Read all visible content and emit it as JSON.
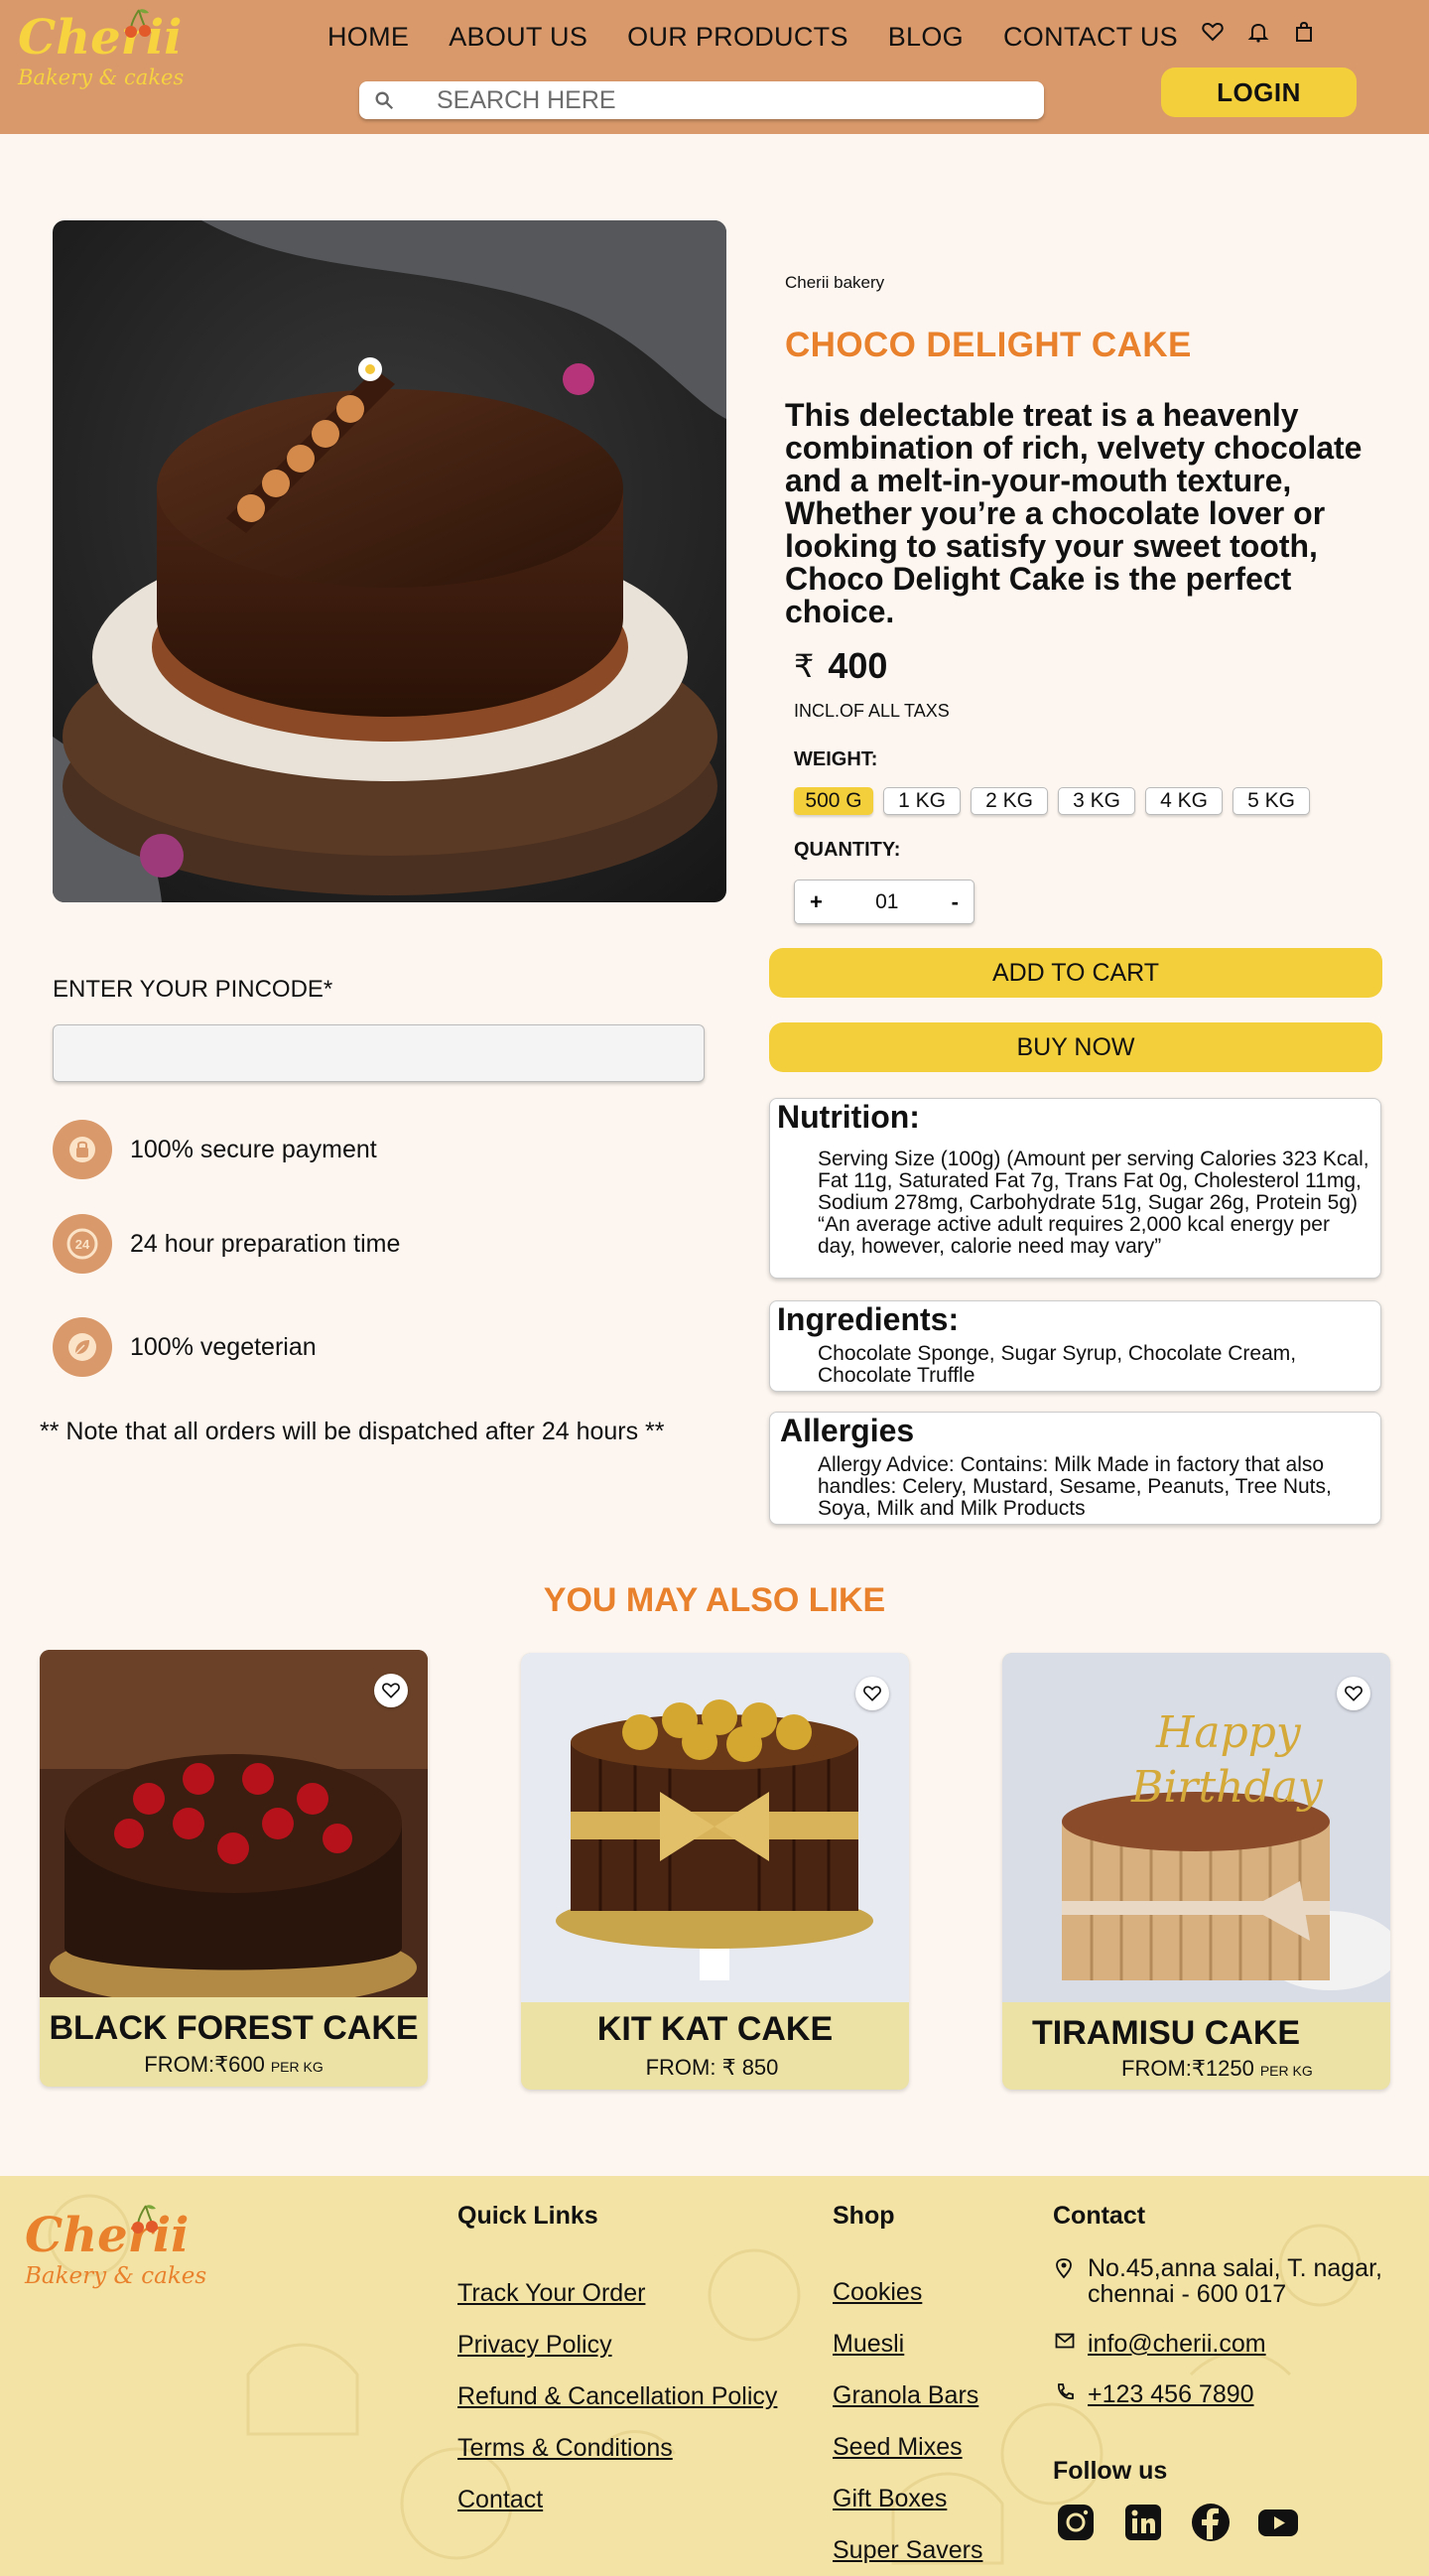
{
  "header": {
    "logo_main": "Cherii",
    "logo_sub": "Bakery & cakes",
    "nav": [
      "HOME",
      "ABOUT US",
      "OUR PRODUCTS",
      "BLOG",
      "CONTACT US"
    ],
    "search_placeholder": "SEARCH HERE",
    "icons": [
      "heart-icon",
      "bell-icon",
      "bag-icon"
    ],
    "login_label": "LOGIN"
  },
  "product": {
    "brand": "Cherii bakery",
    "title": "CHOCO DELIGHT CAKE",
    "description": "This delectable treat is a heavenly combination of rich, velvety chocolate and a melt-in-your-mouth texture, Whether you’re a chocolate lover or looking to satisfy your sweet tooth, Choco Delight Cake is the perfect choice.",
    "currency": "₹",
    "price": "400",
    "taxes": "INCL.OF ALL TAXS",
    "weight_label": "WEIGHT:",
    "weights": [
      "500 G",
      "1 KG",
      "2 KG",
      "3 KG",
      "4 KG",
      "5 KG"
    ],
    "selected_weight": "500 G",
    "quantity_label": "QUANTITY:",
    "quantity_plus": "+",
    "quantity_value": "01",
    "quantity_minus": "-",
    "add_to_cart": "ADD TO CART",
    "buy_now": "BUY NOW"
  },
  "pincode": {
    "label": "ENTER YOUR PINCODE*",
    "value": ""
  },
  "features": [
    {
      "icon": "lock-icon",
      "text": "100% secure payment"
    },
    {
      "icon": "clock-24-icon",
      "text": "24 hour preparation time"
    },
    {
      "icon": "leaf-icon",
      "text": "100% vegeterian"
    }
  ],
  "note": "** Note that all orders will be dispatched after 24 hours **",
  "nutrition": {
    "title": "Nutrition:",
    "text": "Serving Size (100g) (Amount per serving Calories 323 Kcal, Fat 11g, Saturated Fat 7g, Trans Fat 0g, Cholesterol 11mg, Sodium 278mg, Carbohydrate 51g, Sugar 26g, Protein 5g) “An average active adult requires 2,000 kcal energy per day, however, calorie need may vary”"
  },
  "ingredients": {
    "title": "Ingredients:",
    "text": "Chocolate Sponge, Sugar Syrup, Chocolate Cream, Chocolate Truffle"
  },
  "allergies": {
    "title": "Allergies",
    "text": "Allergy Advice: Contains: Milk Made in factory that also handles: Celery, Mustard, Sesame, Peanuts, Tree Nuts, Soya, Milk and Milk Products"
  },
  "related": {
    "title": "YOU MAY ALSO LIKE",
    "items": [
      {
        "name": "BLACK FOREST CAKE",
        "price": "FROM:₹600",
        "unit": "PER KG"
      },
      {
        "name": "KIT KAT CAKE",
        "price": "FROM: ₹ 850",
        "unit": ""
      },
      {
        "name": "TIRAMISU CAKE",
        "price": "FROM:₹1250",
        "unit": "PER KG"
      }
    ]
  },
  "footer": {
    "logo_main": "Cherii",
    "logo_sub": "Bakery & cakes",
    "quick_links_title": "Quick Links",
    "quick_links": [
      "Track Your Order",
      "Privacy Policy",
      "Refund & Cancellation Policy",
      "Terms & Conditions",
      "Contact"
    ],
    "shop_title": "Shop",
    "shop_links": [
      "Cookies",
      "Muesli",
      "Granola Bars",
      "Seed Mixes",
      "Gift Boxes",
      "Super Savers"
    ],
    "contact_title": "Contact",
    "address": "No.45,anna salai, T. nagar, chennai - 600 017",
    "email": "info@cherii.com",
    "phone": "+123 456 7890",
    "follow_title": "Follow us",
    "social": [
      "instagram-icon",
      "linkedin-icon",
      "facebook-icon",
      "youtube-icon"
    ]
  },
  "colors": {
    "header_bg": "#d9996a",
    "accent_yellow": "#f4cf3c",
    "title_orange": "#e8802c",
    "page_bg": "#fdf6f0",
    "footer_bg": "#f3e3a5"
  }
}
